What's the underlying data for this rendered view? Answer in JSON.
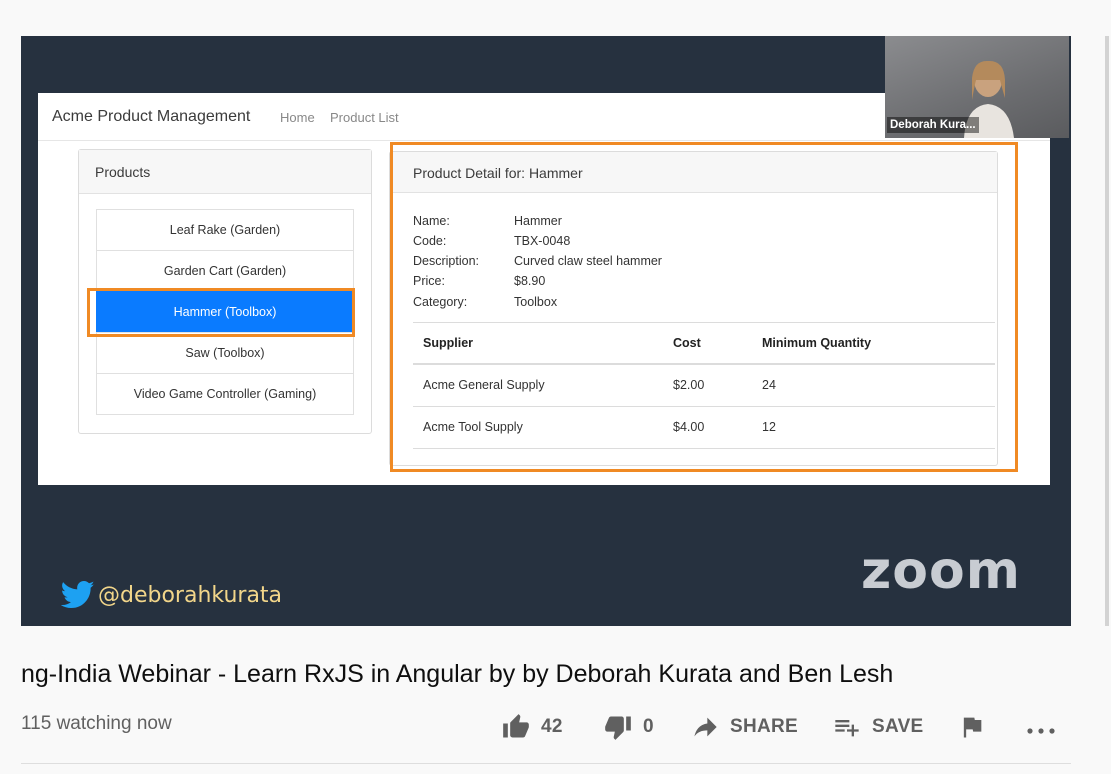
{
  "app": {
    "brand": "Acme Product Management",
    "nav": [
      "Home",
      "Product List"
    ]
  },
  "products_panel": {
    "title": "Products",
    "items": [
      "Leaf Rake (Garden)",
      "Garden Cart (Garden)",
      "Hammer (Toolbox)",
      "Saw (Toolbox)",
      "Video Game Controller (Gaming)"
    ],
    "selected_index": 2
  },
  "detail": {
    "title": "Product Detail for: Hammer",
    "fields": [
      {
        "label": "Name:",
        "value": "Hammer"
      },
      {
        "label": "Code:",
        "value": "TBX-0048"
      },
      {
        "label": "Description:",
        "value": "Curved claw steel hammer"
      },
      {
        "label": "Price:",
        "value": "$8.90"
      },
      {
        "label": "Category:",
        "value": "Toolbox"
      }
    ],
    "table": {
      "headers": [
        "Supplier",
        "Cost",
        "Minimum Quantity"
      ],
      "rows": [
        [
          "Acme General Supply",
          "$2.00",
          "24"
        ],
        [
          "Acme Tool Supply",
          "$4.00",
          "12"
        ]
      ]
    }
  },
  "video_overlay": {
    "participant_name": "Deborah Kura...",
    "twitter_handle": "@deborahkurata",
    "zoom_logo": "zoom"
  },
  "video_info": {
    "title": "ng-India Webinar - Learn RxJS in Angular by by Deborah Kurata and Ben Lesh",
    "watching": "115 watching now",
    "likes": "42",
    "dislikes": "0",
    "share_label": "SHARE",
    "save_label": "SAVE"
  },
  "colors": {
    "highlight": "#f08a24",
    "selected": "#0a7bff",
    "video_bg": "#26313f",
    "twitter": "#1da1f2"
  },
  "icons": [
    "twitter-icon",
    "thumbs-up-icon",
    "thumbs-down-icon",
    "share-icon",
    "playlist-add-icon",
    "flag-icon",
    "more-icon"
  ]
}
